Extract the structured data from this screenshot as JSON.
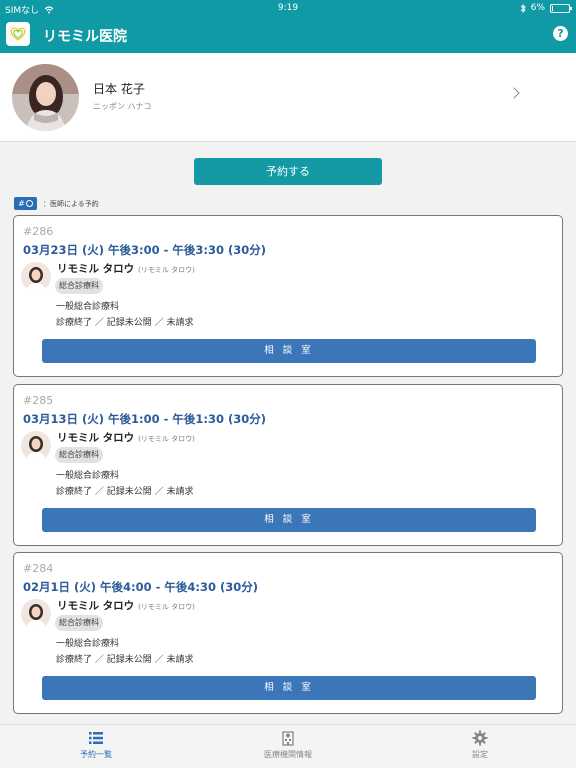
{
  "statusbar": {
    "carrier": "SIMなし",
    "time": "9:19",
    "battery": "6%",
    "battery_level": 0.06
  },
  "app": {
    "title": "リモミル医院"
  },
  "profile": {
    "name": "日本 花子",
    "kana": "ニッポン ハナコ"
  },
  "actions": {
    "reserve_label": "予約する"
  },
  "legend": {
    "chip": "#",
    "text": "：医師による予約"
  },
  "appointments": [
    {
      "number": "#286",
      "datetime": "03月23日 (火) 午後3:00 - 午後3:30 (30分)",
      "doctor": "リモミル タロウ",
      "doctor_kana": "(リモミル タロウ)",
      "department": "総合診療科",
      "menu": "一般総合診療科",
      "status": "診療終了 ／ 記録未公開 ／ 未請求",
      "room_label": "相 談 室"
    },
    {
      "number": "#285",
      "datetime": "03月13日 (火) 午後1:00 - 午後1:30 (30分)",
      "doctor": "リモミル タロウ",
      "doctor_kana": "(リモミル タロウ)",
      "department": "総合診療科",
      "menu": "一般総合診療科",
      "status": "診療終了 ／ 記録未公開 ／ 未請求",
      "room_label": "相 談 室"
    },
    {
      "number": "#284",
      "datetime": "02月1日 (火) 午後4:00 - 午後4:30 (30分)",
      "doctor": "リモミル タロウ",
      "doctor_kana": "(リモミル タロウ)",
      "department": "総合診療科",
      "menu": "一般総合診療科",
      "status": "診療終了 ／ 記録未公開 ／ 未請求",
      "room_label": "相 談 室"
    }
  ],
  "tabs": [
    {
      "label": "予約一覧",
      "icon": "list-icon",
      "active": true
    },
    {
      "label": "医療機関情報",
      "icon": "hospital-icon",
      "active": false
    },
    {
      "label": "設定",
      "icon": "gear-icon",
      "active": false
    }
  ],
  "colors": {
    "brand": "#0f9aa6",
    "accent": "#2a6db5",
    "room_button": "#3b77b8",
    "date_text": "#2a5a9a"
  }
}
